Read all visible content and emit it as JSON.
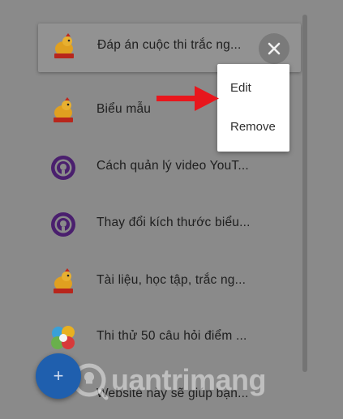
{
  "list": {
    "items": [
      {
        "label": "Đáp án cuộc thi trắc ng...",
        "icon": "chicken-logo-icon"
      },
      {
        "label": "Biểu mẫu",
        "icon": "chicken-logo-icon"
      },
      {
        "label": "Cách quản lý video YouT...",
        "icon": "purple-circle-logo-icon"
      },
      {
        "label": "Thay đổi kích thước biểu...",
        "icon": "purple-circle-logo-icon"
      },
      {
        "label": "Tài liệu, học tập, trắc ng...",
        "icon": "chicken-logo-icon"
      },
      {
        "label": "Thi thử 50 câu hỏi điểm ...",
        "icon": "colorful-bubbles-icon"
      },
      {
        "label": "Website này sẽ giúp bạn..."
      }
    ]
  },
  "context_menu": {
    "edit_label": "Edit",
    "remove_label": "Remove"
  },
  "fab": {
    "label": "+"
  },
  "watermark": {
    "text": "uantrimang"
  },
  "colors": {
    "overlay_bg": "#8a8a8a",
    "fab": "#1f5fae",
    "arrow": "#e8161c",
    "menu_bg": "#ffffff"
  }
}
